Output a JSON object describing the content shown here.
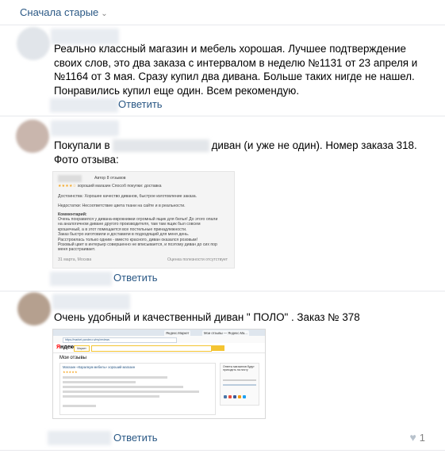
{
  "sort_label": "Сначала старые",
  "icons": {
    "sort": "chevron-down-icon",
    "like": "heart-icon"
  },
  "colors": {
    "link": "#2a5885",
    "muted": "#828282",
    "separator": "#e7e8ec"
  },
  "comments": [
    {
      "text": "Реально классный магазин и мебель хорошая. Лучшее подтверждение своих слов, это два заказа с интервалом в неделю №1131 от 23 апреля и №1164 от 3 мая. Сразу купил два дивана. Больше таких нигде не нашел. Понравились купил еще один. Всем рекомендую.",
      "reply_label": "Ответить"
    },
    {
      "text_before": "Покупали в",
      "text_after": "диван (и уже не один). Номер заказа 318. Фото отзыва:",
      "reply_label": "Ответить",
      "review": {
        "author": "Автор 8 отзывов",
        "stars": "★★★★☆",
        "rating_text": "хороший магазин",
        "method": "Способ покупки: доставка",
        "pros": "Достоинства: Хорошее качество диванов, быстрое изготовление заказа.",
        "cons": "Недостатки: Несоответствие цвета ткани на сайте и в реальности.",
        "comment_title": "Комментарий:",
        "comment_lines": [
          "Очень понравился у дивана-еврокнижки огромный ящик для белья! До этого опали",
          "на аналогичном диване другого производителя, там там ящик был совсем",
          "крошечный, а в этот помещается все постельные принадлежности.",
          "Заказ быстро изготовили и доставили в подходящий для меня день.",
          "Расстроилась только одним - вместо красного, диван оказался розовым!",
          "Розовый цвет в интерьер совершенно не вписывается, и поэтому диван до сих пор",
          "меня расстраивает."
        ],
        "date": "31 марта, Москва",
        "helpfulness": "Оценка полезности отсутствует"
      }
    },
    {
      "text": "Очень удобный и качественный диван \" ПОЛО\" . Заказ № 378",
      "reply_label": "Ответить",
      "likes": "1",
      "screenshot": {
        "logo_first": "Я",
        "logo_rest": "ндекс",
        "market_label": "Маркет",
        "page_title": "Мои отзывы",
        "url": "https://market.yandex.ru/my/reviews",
        "tab_labels": [
          "Яндекс.Маркет",
          "Мои отзывы — Яндекс.Ма..."
        ],
        "review_shop": "Магазин «Каралкум мебель» хороший магазин",
        "review_stars": "★★★★★",
        "side_text": "Ответы магазинов будут приходить на почту"
      }
    }
  ]
}
